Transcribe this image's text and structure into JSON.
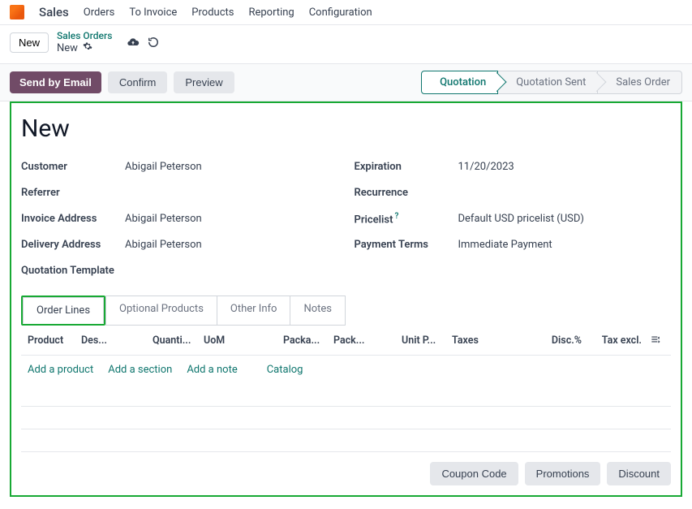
{
  "nav": {
    "app": "Sales",
    "items": [
      "Orders",
      "To Invoice",
      "Products",
      "Reporting",
      "Configuration"
    ]
  },
  "breadcrumb": {
    "new_button": "New",
    "parent": "Sales Orders",
    "current": "New"
  },
  "actions": {
    "send_email": "Send by Email",
    "confirm": "Confirm",
    "preview": "Preview"
  },
  "stages": {
    "quotation": "Quotation",
    "quotation_sent": "Quotation Sent",
    "sales_order": "Sales Order"
  },
  "title": "New",
  "fields": {
    "left": {
      "customer_label": "Customer",
      "customer_value": "Abigail Peterson",
      "referrer_label": "Referrer",
      "referrer_value": "",
      "invoice_label": "Invoice Address",
      "invoice_value": "Abigail Peterson",
      "delivery_label": "Delivery Address",
      "delivery_value": "Abigail Peterson",
      "template_label": "Quotation Template",
      "template_value": ""
    },
    "right": {
      "expiration_label": "Expiration",
      "expiration_value": "11/20/2023",
      "recurrence_label": "Recurrence",
      "recurrence_value": "",
      "pricelist_label": "Pricelist",
      "pricelist_value": "Default USD pricelist (USD)",
      "payment_label": "Payment Terms",
      "payment_value": "Immediate Payment"
    }
  },
  "tabs": {
    "order_lines": "Order Lines",
    "optional": "Optional Products",
    "other": "Other Info",
    "notes": "Notes"
  },
  "columns": {
    "product": "Product",
    "description": "Des...",
    "quantity": "Quanti...",
    "uom": "UoM",
    "packaging": "Packa...",
    "pack": "Pack...",
    "unit_price": "Unit P...",
    "taxes": "Taxes",
    "discount": "Disc.%",
    "tax_excl": "Tax excl."
  },
  "line_actions": {
    "add_product": "Add a product",
    "add_section": "Add a section",
    "add_note": "Add a note",
    "catalog": "Catalog"
  },
  "footer": {
    "coupon": "Coupon Code",
    "promotions": "Promotions",
    "discount": "Discount"
  }
}
